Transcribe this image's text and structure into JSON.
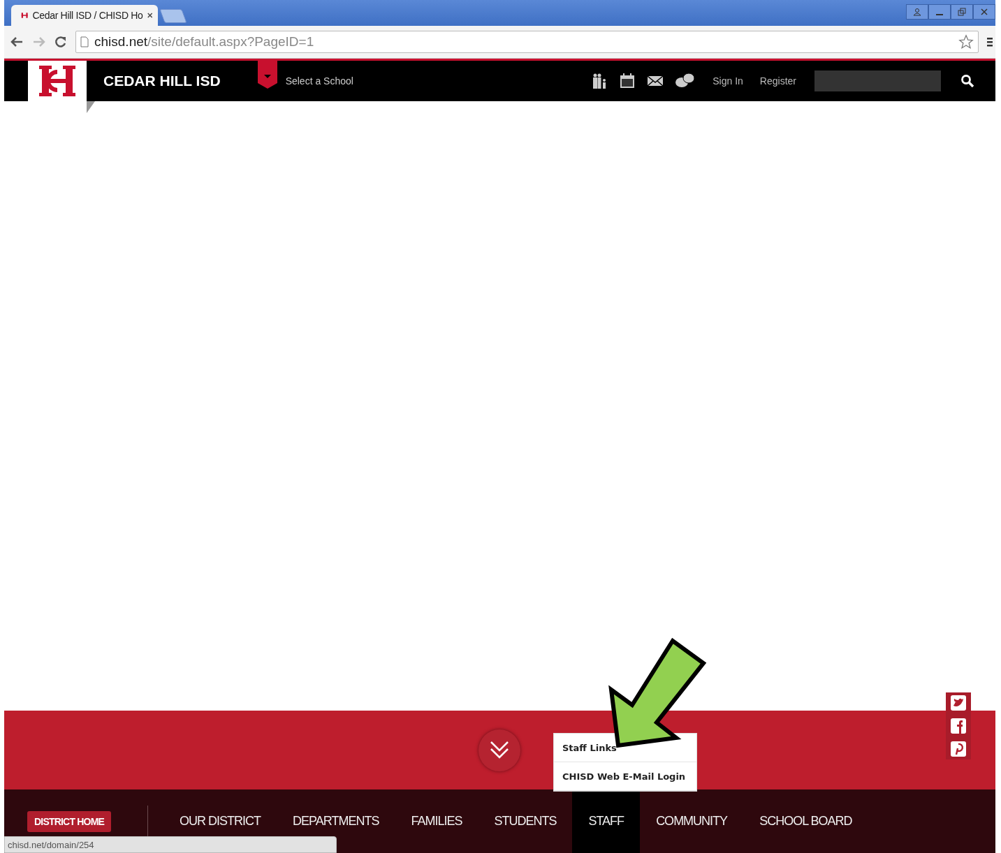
{
  "browser": {
    "tab": {
      "title": "Cedar Hill ISD / CHISD Ho"
    },
    "address": {
      "domain": "chisd.net",
      "path": "/site/default.aspx?PageID=1"
    },
    "status_url": "chisd.net/domain/254"
  },
  "header": {
    "site_name": "CEDAR HILL ISD",
    "school_selector": "Select a School",
    "links": [
      "Sign In",
      "Register"
    ]
  },
  "dropdown": {
    "items": [
      "Staff Links",
      "CHISD Web E-Mail Login"
    ]
  },
  "nav": {
    "home": "DISTRICT HOME",
    "items": [
      {
        "label": "OUR DISTRICT",
        "selected": false
      },
      {
        "label": "DEPARTMENTS",
        "selected": false
      },
      {
        "label": "FAMILIES",
        "selected": false
      },
      {
        "label": "STUDENTS",
        "selected": false
      },
      {
        "label": "STAFF",
        "selected": true
      },
      {
        "label": "COMMUNITY",
        "selected": false
      },
      {
        "label": "SCHOOL BOARD",
        "selected": false
      }
    ]
  }
}
